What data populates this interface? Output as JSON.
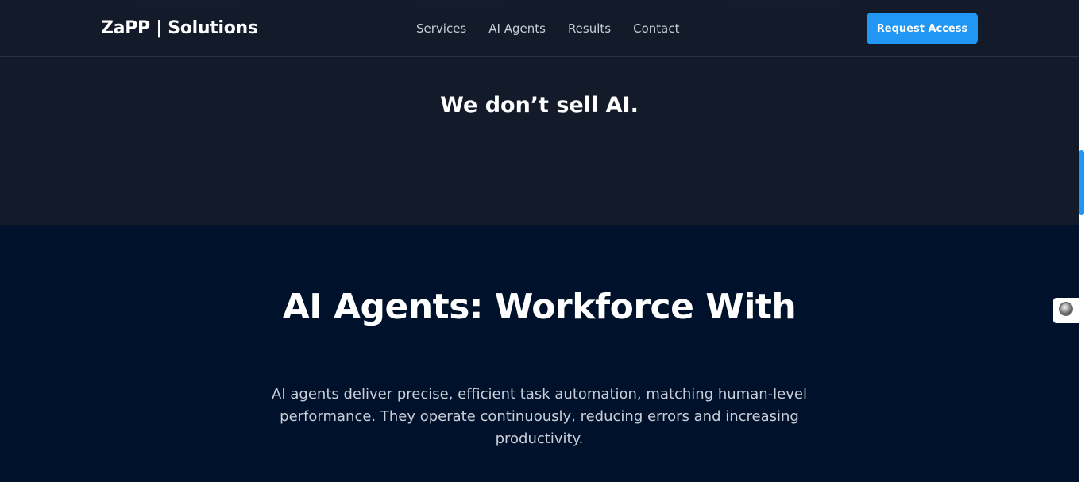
{
  "header": {
    "brand": "ZaPP | Solutions",
    "nav": [
      {
        "label": "Services"
      },
      {
        "label": "AI Agents"
      },
      {
        "label": "Results"
      },
      {
        "label": "Contact"
      }
    ],
    "cta_label": "Request Access"
  },
  "hero": {
    "tagline": "We don’t sell AI."
  },
  "agents_section": {
    "title": "AI Agents: Workforce With",
    "description": "AI agents deliver precise, efficient task automation, matching human-level performance. They operate continuously, reducing errors and increasing productivity."
  },
  "floating_widget": {
    "icon": "circle-badge-icon"
  },
  "colors": {
    "accent": "#2196f3",
    "hero_bg": "#131a29",
    "section_bg": "#00112b",
    "text_primary": "#ffffff",
    "text_muted": "#c9ced8"
  }
}
